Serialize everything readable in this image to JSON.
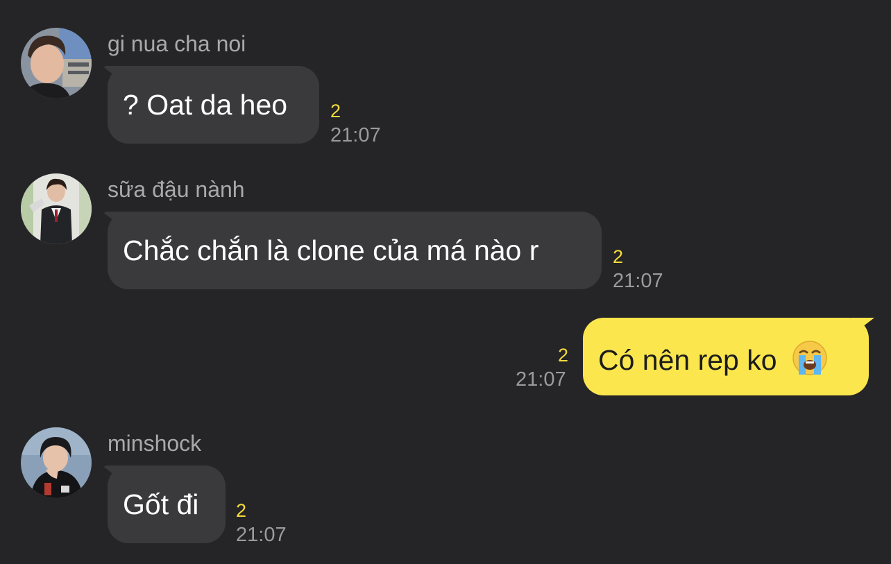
{
  "messages": [
    {
      "sender": "gi nua cha noi",
      "text": "? Oat da heo",
      "unread": "2",
      "time": "21:07",
      "avatar_icon": "profile-photo-icon"
    },
    {
      "sender": "sữa đậu nành",
      "text": "Chắc chắn là clone của má nào r",
      "unread": "2",
      "time": "21:07",
      "avatar_icon": "profile-photo-icon"
    },
    {
      "sender": "",
      "text": "Có nên rep ko",
      "emoji": "loudly-crying-face-icon",
      "unread": "2",
      "time": "21:07"
    },
    {
      "sender": "minshock",
      "text": "Gốt đi",
      "unread": "2",
      "time": "21:07",
      "avatar_icon": "profile-photo-icon"
    }
  ],
  "colors": {
    "background": "#252527",
    "incoming_bubble": "#3a3a3c",
    "outgoing_bubble": "#fbe74d",
    "unread_count": "#f4dc3c",
    "timestamp": "#9b9b9f"
  }
}
